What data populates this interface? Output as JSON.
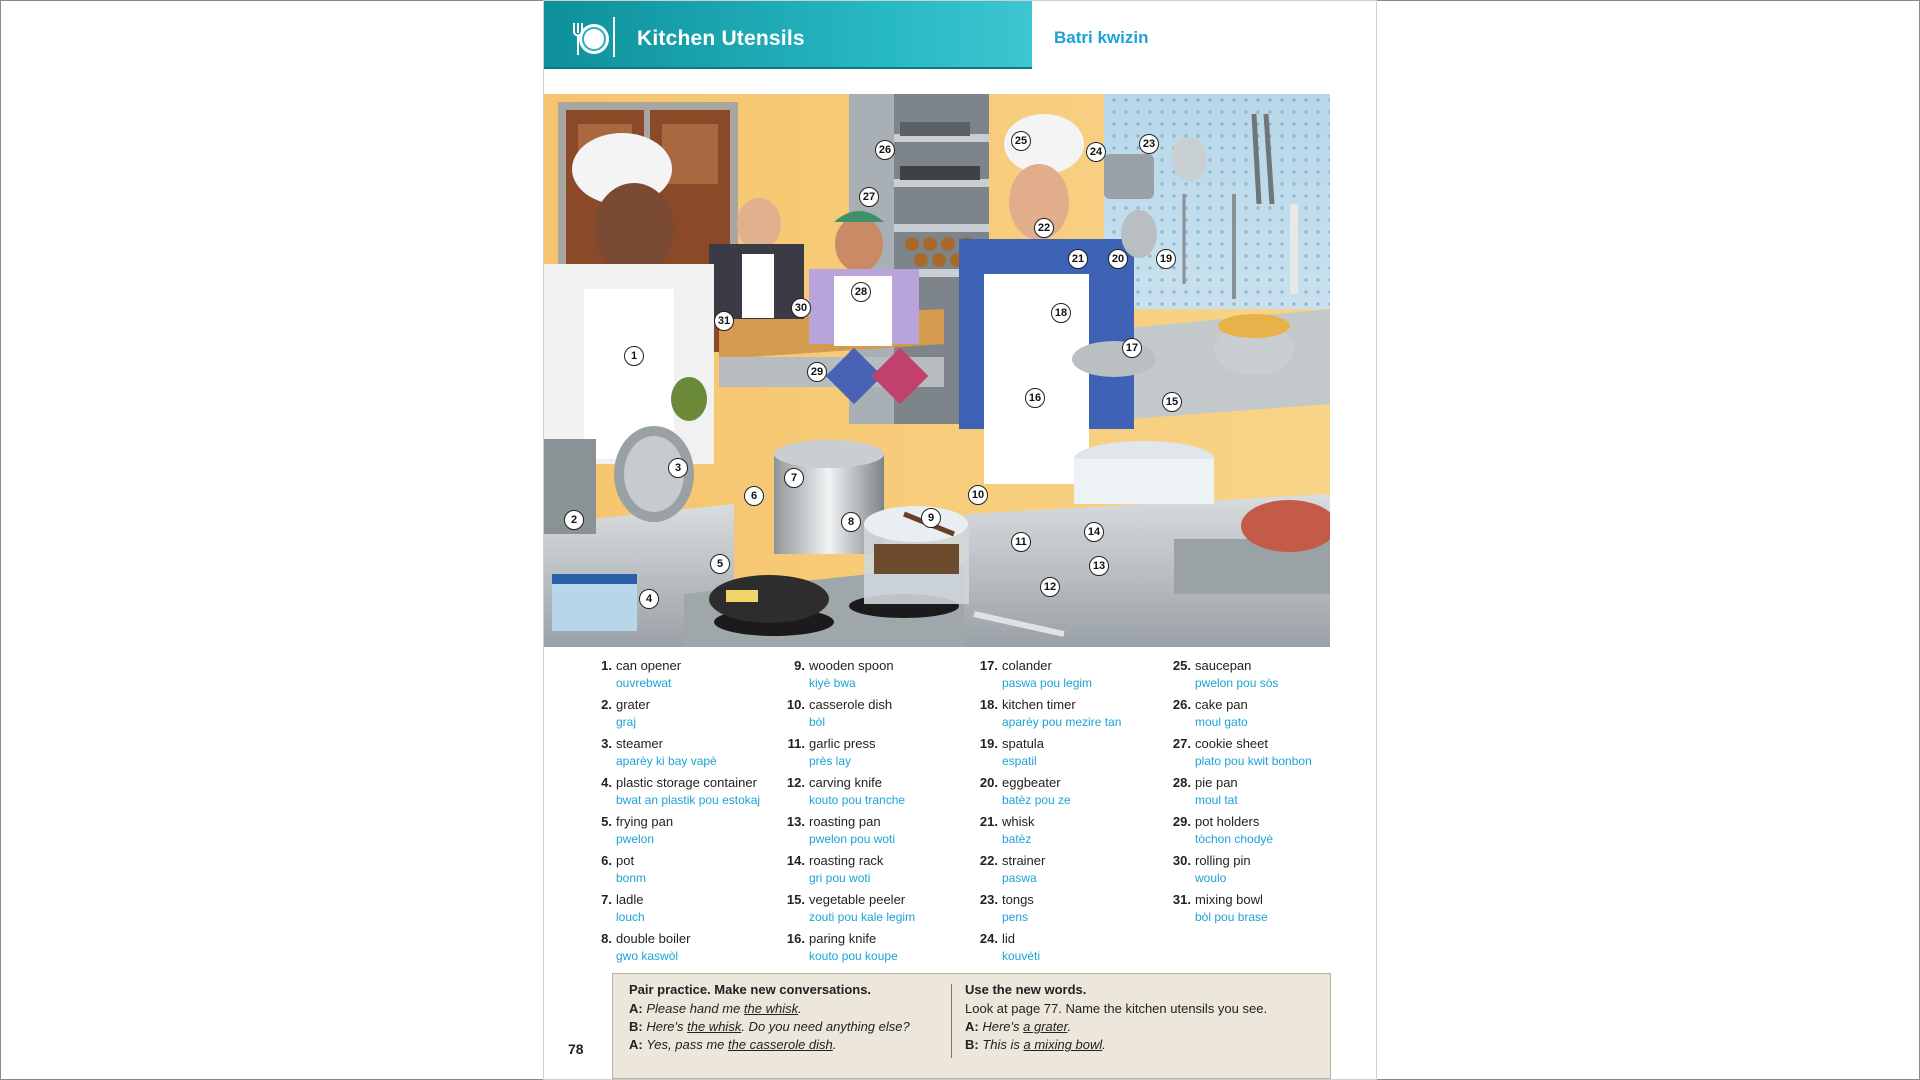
{
  "header": {
    "title": "Kitchen Utensils",
    "translation_title": "Batri kwizin",
    "icon": "plate-fork-icon"
  },
  "illustration": {
    "description_icon": "kitchen-scene",
    "callouts": [
      "1",
      "2",
      "3",
      "4",
      "5",
      "6",
      "7",
      "8",
      "9",
      "10",
      "11",
      "12",
      "13",
      "14",
      "15",
      "16",
      "17",
      "18",
      "19",
      "20",
      "21",
      "22",
      "23",
      "24",
      "25",
      "26",
      "27",
      "28",
      "29",
      "30",
      "31"
    ]
  },
  "vocab": [
    [
      {
        "num": "1.",
        "en": "can opener",
        "ht": "ouvrebwat"
      },
      {
        "num": "2.",
        "en": "grater",
        "ht": "graj"
      },
      {
        "num": "3.",
        "en": "steamer",
        "ht": "aparèy ki bay vapè"
      },
      {
        "num": "4.",
        "en": "plastic storage container",
        "ht": "bwat an plastik pou estokaj"
      },
      {
        "num": "5.",
        "en": "frying pan",
        "ht": "pwelon"
      },
      {
        "num": "6.",
        "en": "pot",
        "ht": "bonm"
      },
      {
        "num": "7.",
        "en": "ladle",
        "ht": "louch"
      },
      {
        "num": "8.",
        "en": "double boiler",
        "ht": "gwo kaswòl"
      }
    ],
    [
      {
        "num": "9.",
        "en": "wooden spoon",
        "ht": "kiyè bwa"
      },
      {
        "num": "10.",
        "en": "casserole dish",
        "ht": "bòl"
      },
      {
        "num": "11.",
        "en": "garlic press",
        "ht": "près lay"
      },
      {
        "num": "12.",
        "en": "carving knife",
        "ht": "kouto pou tranche"
      },
      {
        "num": "13.",
        "en": "roasting pan",
        "ht": "pwelon pou woti"
      },
      {
        "num": "14.",
        "en": "roasting rack",
        "ht": "gri pou woti"
      },
      {
        "num": "15.",
        "en": "vegetable peeler",
        "ht": "zouti pou kale legim"
      },
      {
        "num": "16.",
        "en": "paring knife",
        "ht": "kouto pou koupe"
      }
    ],
    [
      {
        "num": "17.",
        "en": "colander",
        "ht": "paswa pou legim"
      },
      {
        "num": "18.",
        "en": "kitchen timer",
        "ht": "aparèy pou mezire tan"
      },
      {
        "num": "19.",
        "en": "spatula",
        "ht": "espatil"
      },
      {
        "num": "20.",
        "en": "eggbeater",
        "ht": "batèz pou ze"
      },
      {
        "num": "21.",
        "en": "whisk",
        "ht": "batèz"
      },
      {
        "num": "22.",
        "en": "strainer",
        "ht": "paswa"
      },
      {
        "num": "23.",
        "en": "tongs",
        "ht": "pens"
      },
      {
        "num": "24.",
        "en": "lid",
        "ht": "kouvèti"
      }
    ],
    [
      {
        "num": "25.",
        "en": "saucepan",
        "ht": "pwelon pou sòs"
      },
      {
        "num": "26.",
        "en": "cake pan",
        "ht": "moul gato"
      },
      {
        "num": "27.",
        "en": "cookie sheet",
        "ht": "plato pou kwit bonbon"
      },
      {
        "num": "28.",
        "en": "pie pan",
        "ht": "moul tat"
      },
      {
        "num": "29.",
        "en": "pot holders",
        "ht": "tòchon chodyè"
      },
      {
        "num": "30.",
        "en": "rolling pin",
        "ht": "woulo"
      },
      {
        "num": "31.",
        "en": "mixing bowl",
        "ht": "bòl pou brase"
      }
    ]
  ],
  "practice": {
    "left_title": "Pair practice. Make new conversations.",
    "left_lines": [
      {
        "speaker": "A:",
        "pre": "Please hand me ",
        "u": "the whisk",
        "post": "."
      },
      {
        "speaker": "B:",
        "pre": "Here's ",
        "u": "the whisk",
        "post": ". Do you need anything else?"
      },
      {
        "speaker": "A:",
        "pre": "Yes, pass me ",
        "u": "the casserole dish",
        "post": "."
      }
    ],
    "right_title": "Use the new words.",
    "right_intro": "Look at page 77. Name the kitchen utensils you see.",
    "right_lines": [
      {
        "speaker": "A:",
        "pre": "Here's ",
        "u": "a grater",
        "post": "."
      },
      {
        "speaker": "B:",
        "pre": "This is ",
        "u": "a mixing bowl",
        "post": "."
      }
    ]
  },
  "page_number": "78"
}
